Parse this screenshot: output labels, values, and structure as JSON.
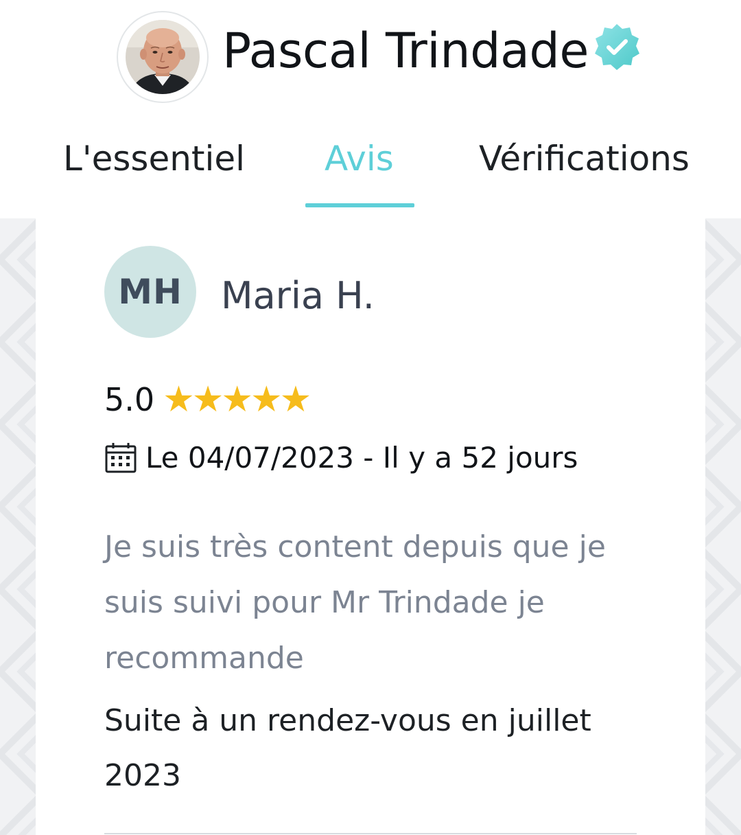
{
  "profile": {
    "name": "Pascal Trindade",
    "verified": true,
    "avatar_icon": "person-photo"
  },
  "tabs": [
    {
      "label": "L'essentiel",
      "active": false
    },
    {
      "label": "Avis",
      "active": true
    },
    {
      "label": "Vérifications",
      "active": false
    }
  ],
  "review": {
    "initials": "MH",
    "reviewer_name": "Maria H.",
    "rating": "5.0",
    "stars": 5,
    "date_text": "Le 04/07/2023 - Il y a 52 jours",
    "comment": "Je suis très content depuis que je suis suivi pour Mr Trindade je recommande",
    "context": "Suite à un rendez-vous en juillet 2023"
  },
  "colors": {
    "accent": "#5ecfd8",
    "star": "#f6bc1c",
    "initials_bg": "#cfe5e4",
    "comment_text": "#7c8492"
  }
}
